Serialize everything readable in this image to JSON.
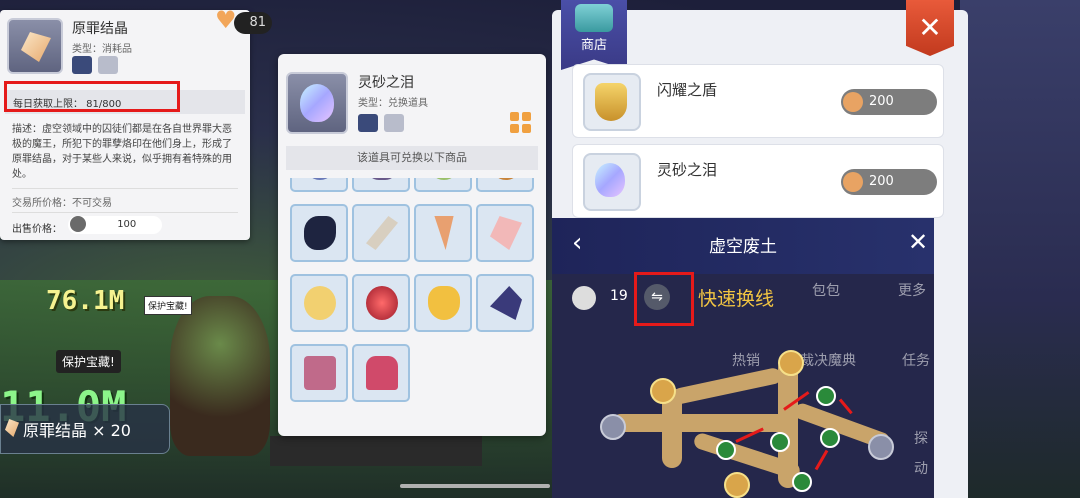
{
  "item_tip": {
    "name": "原罪结晶",
    "type": "类型：消耗品",
    "counter": "81",
    "limit": "每日获取上限： 81/800",
    "description": "描述：虚空领域中的囚徒们都是在各自世界罪大恶极的魔王，所犯下的罪孽烙印在他们身上，形成了原罪结晶，对于某些人来说，似乎拥有着特殊的用处。",
    "trade": "交易所价格：不可交易",
    "sell_label": "出售价格：",
    "sell_value": "100"
  },
  "exchange_tip": {
    "name": "灵砂之泪",
    "type": "类型：兑换道具",
    "subtitle": "该道具可兑换以下商品"
  },
  "shop": {
    "tab_label": "商店",
    "close_symbol": "✕",
    "items": [
      {
        "name": "闪耀之盾",
        "price": "200"
      },
      {
        "name": "灵砂之泪",
        "price": "200"
      }
    ]
  },
  "map": {
    "title": "虚空废土",
    "back_symbol": "‹",
    "close_symbol": "✕",
    "line_number": "19",
    "swap_symbol": "⇋",
    "fast_switch": "快速换线",
    "bg_words": [
      "包包",
      "更多",
      "热销",
      "裁决魔典",
      "任务",
      "探",
      "动"
    ]
  },
  "battle": {
    "damage_top": "76.1M",
    "damage_bottom": "11.0M",
    "bubble_small": "保护宝藏!",
    "bubble_large": "保护宝藏!",
    "loot_text": "原罪结晶 × 20"
  },
  "colors": {
    "highlight_red": "#e51a1a",
    "fast_switch_yellow": "#f2c542",
    "close_red": "#d9472a"
  }
}
